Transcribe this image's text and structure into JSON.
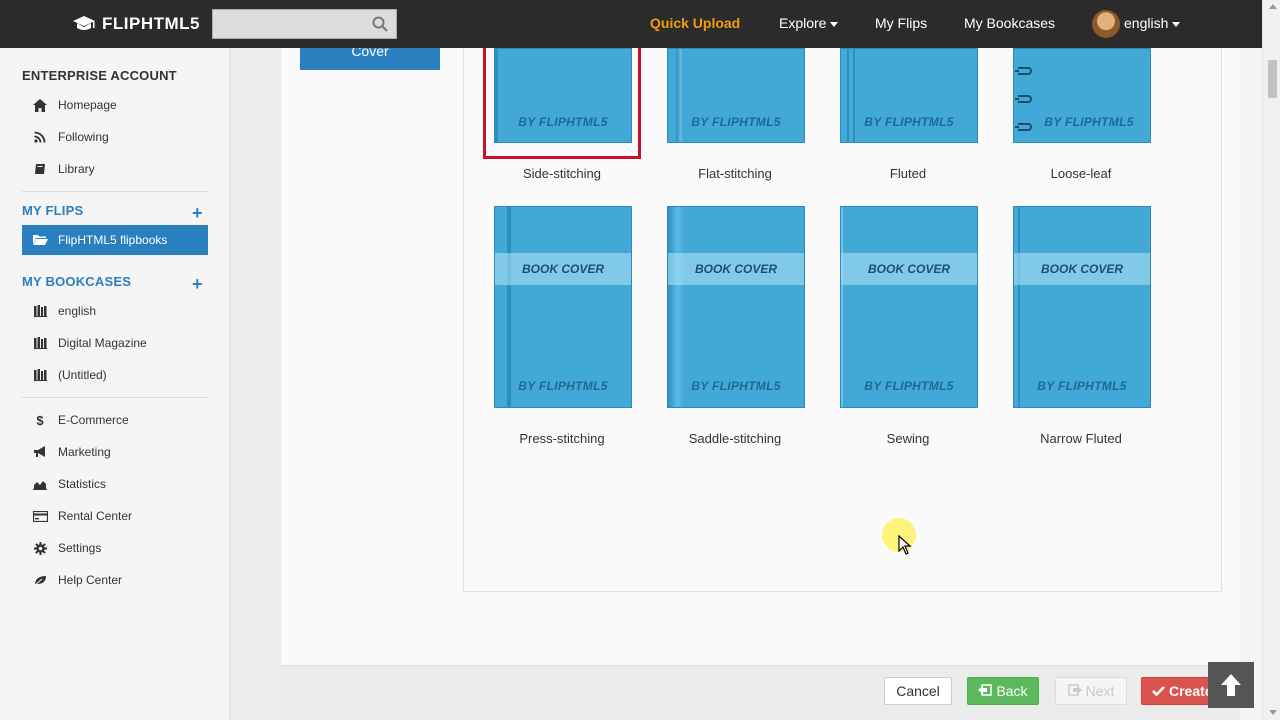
{
  "topbar": {
    "logo_text": "FLIPHTML5",
    "search_placeholder": "",
    "nav": {
      "quick_upload": "Quick Upload",
      "explore": "Explore",
      "my_flips": "My Flips",
      "my_bookcases": "My Bookcases",
      "language": "english"
    }
  },
  "sidebar": {
    "account_heading": "ENTERPRISE ACCOUNT",
    "account_items": [
      {
        "label": "Homepage",
        "icon": "home-icon"
      },
      {
        "label": "Following",
        "icon": "rss-icon"
      },
      {
        "label": "Library",
        "icon": "book-icon"
      }
    ],
    "my_flips_heading": "MY FLIPS",
    "my_flips_items": [
      {
        "label": "FlipHTML5 flipbooks",
        "icon": "folder-open-icon"
      }
    ],
    "my_bookcases_heading": "MY BOOKCASES",
    "bookcase_items": [
      {
        "label": "english",
        "icon": "bookshelf-icon"
      },
      {
        "label": "Digital Magazine",
        "icon": "bookshelf-icon"
      },
      {
        "label": "(Untitled)",
        "icon": "bookshelf-icon"
      }
    ],
    "tool_items": [
      {
        "label": "E-Commerce",
        "icon": "dollar-icon"
      },
      {
        "label": "Marketing",
        "icon": "bullhorn-icon"
      },
      {
        "label": "Statistics",
        "icon": "area-chart-icon"
      },
      {
        "label": "Rental Center",
        "icon": "credit-card-icon"
      },
      {
        "label": "Settings",
        "icon": "gear-icon"
      },
      {
        "label": "Help Center",
        "icon": "leaf-icon"
      }
    ]
  },
  "main": {
    "cover_tab_label": "Cover",
    "binding_options": [
      {
        "label": "Side-stitching",
        "band_text": "",
        "by_text": "BY FLIPHTML5",
        "selected": true
      },
      {
        "label": "Flat-stitching",
        "band_text": "",
        "by_text": "BY FLIPHTML5",
        "selected": false
      },
      {
        "label": "Fluted",
        "band_text": "",
        "by_text": "BY FLIPHTML5",
        "selected": false
      },
      {
        "label": "Loose-leaf",
        "band_text": "",
        "by_text": "BY FLIPHTML5",
        "selected": false
      },
      {
        "label": "Press-stitching",
        "band_text": "BOOK COVER",
        "by_text": "BY FLIPHTML5",
        "selected": false
      },
      {
        "label": "Saddle-stitching",
        "band_text": "BOOK COVER",
        "by_text": "BY FLIPHTML5",
        "selected": false
      },
      {
        "label": "Sewing",
        "band_text": "BOOK COVER",
        "by_text": "BY FLIPHTML5",
        "selected": false
      },
      {
        "label": "Narrow Fluted",
        "band_text": "BOOK COVER",
        "by_text": "BY FLIPHTML5",
        "selected": false
      }
    ]
  },
  "footer": {
    "cancel_label": "Cancel",
    "back_label": "Back",
    "next_label": "Next",
    "create_label": "Create"
  },
  "colors": {
    "topbar_bg": "#2b2b2b",
    "accent_orange": "#f39c12",
    "primary_blue": "#2a7fbf",
    "book_blue": "#42a8d8",
    "selected_red": "#c8102e",
    "back_green": "#5cb85c",
    "create_red": "#d9534f"
  }
}
